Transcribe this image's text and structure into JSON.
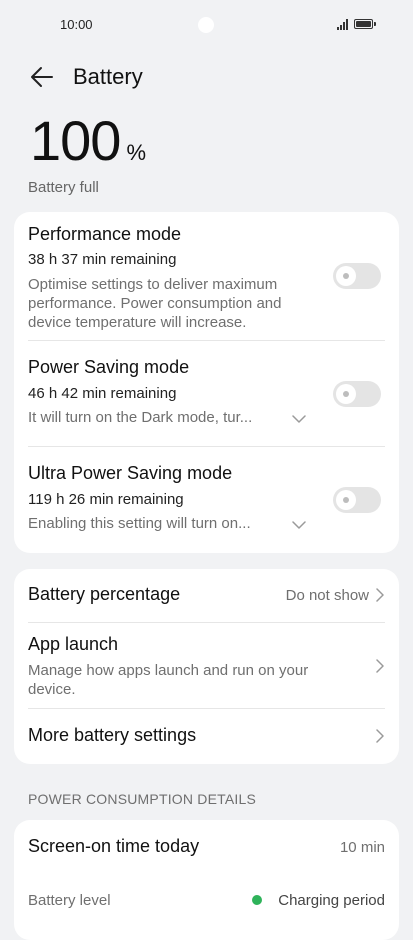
{
  "status_bar": {
    "time": "10:00"
  },
  "header": {
    "title": "Battery"
  },
  "battery": {
    "level": "100",
    "unit": "%",
    "status": "Battery full"
  },
  "modes": [
    {
      "title": "Performance mode",
      "remaining": "38 h 37 min remaining",
      "description": "Optimise settings to deliver maximum performance. Power consumption and device temperature will increase.",
      "enabled": false
    },
    {
      "title": "Power Saving mode",
      "remaining": "46 h 42 min remaining",
      "description": "It will turn on the Dark mode, tur...",
      "enabled": false
    },
    {
      "title": "Ultra Power Saving mode",
      "remaining": "119 h 26 min remaining",
      "description": "Enabling this setting will turn on...",
      "enabled": false
    }
  ],
  "settings": {
    "battery_percentage": {
      "label": "Battery percentage",
      "value": "Do not show"
    },
    "app_launch": {
      "label": "App launch",
      "description": "Manage how apps launch and run on your device."
    },
    "more": {
      "label": "More battery settings"
    }
  },
  "consumption": {
    "section_title": "POWER CONSUMPTION DETAILS",
    "screen_on": {
      "label": "Screen-on time today",
      "value": "10 min"
    },
    "battery_level": {
      "label": "Battery level",
      "legend": "Charging period",
      "legend_color": "#2fb35a"
    }
  }
}
